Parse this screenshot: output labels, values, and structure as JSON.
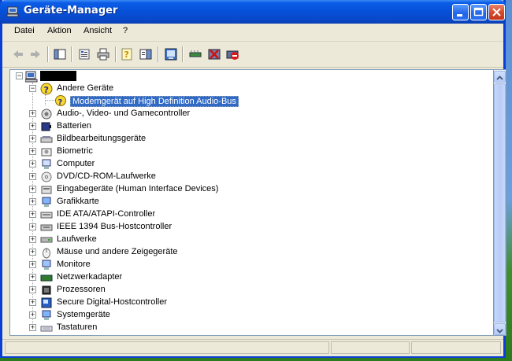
{
  "window": {
    "title": "Geräte-Manager",
    "icons": [
      "device-manager-icon",
      "minimize-icon",
      "maximize-icon",
      "close-icon"
    ]
  },
  "menu": [
    "Datei",
    "Aktion",
    "Ansicht",
    "?"
  ],
  "toolbar": {
    "buttons": [
      "back-icon",
      "forward-icon",
      "console-tree-icon",
      "properties-icon",
      "print-icon",
      "help-icon",
      "action-pane-icon",
      "update-driver-icon",
      "scan-hardware-icon",
      "disable-device-icon",
      "uninstall-device-icon"
    ]
  },
  "tree": {
    "root_label": "",
    "other_devices": "Andere Geräte",
    "modem_device": "Modemgerät auf High Definition Audio-Bus",
    "categories": [
      "Audio-, Video- und Gamecontroller",
      "Batterien",
      "Bildbearbeitungsgeräte",
      "Biometric",
      "Computer",
      "DVD/CD-ROM-Laufwerke",
      "Eingabegeräte (Human Interface Devices)",
      "Grafikkarte",
      "IDE ATA/ATAPI-Controller",
      "IEEE 1394 Bus-Hostcontroller",
      "Laufwerke",
      "Mäuse und andere Zeigegeräte",
      "Monitore",
      "Netzwerkadapter",
      "Prozessoren",
      "Secure Digital-Hostcontroller",
      "Systemgeräte",
      "Tastaturen"
    ]
  },
  "colors": {
    "title_bar": "#0650d8",
    "selection": "#316ac5",
    "window_bg": "#ece9d8"
  }
}
